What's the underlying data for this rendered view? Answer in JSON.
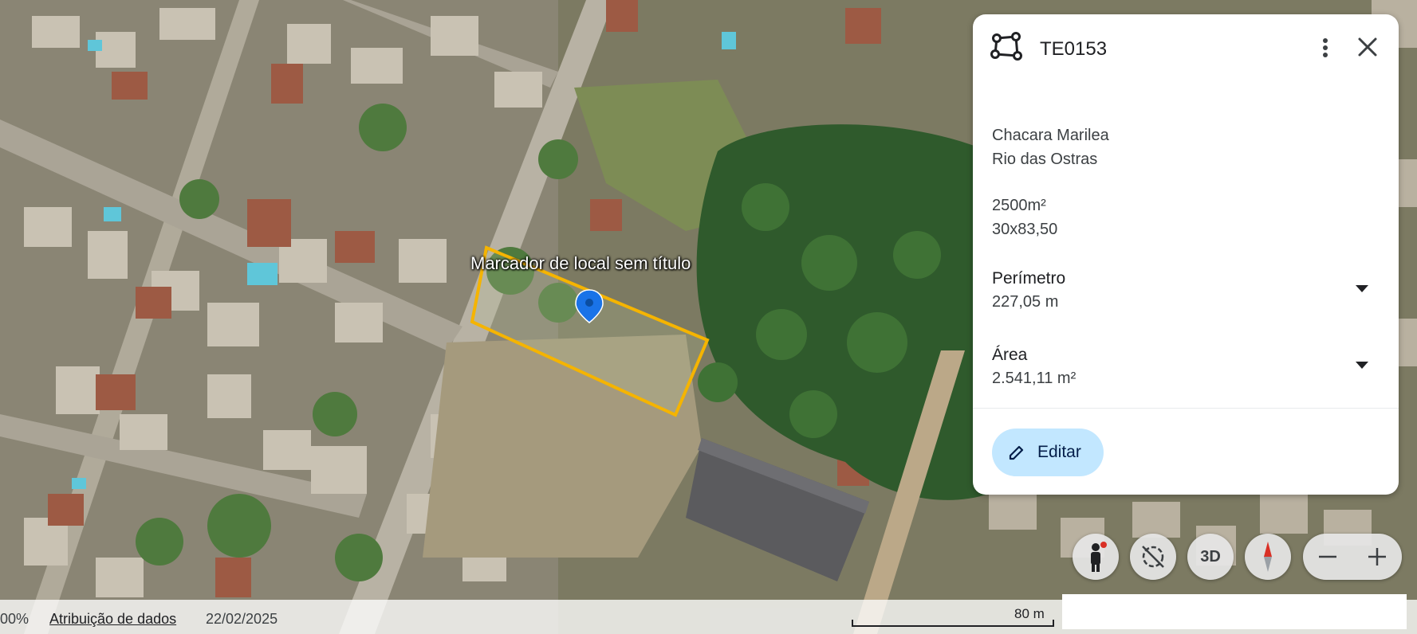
{
  "map": {
    "marker_label": "Marcador de local sem título",
    "polygon_color": "#f5b400",
    "pin_color": "#1a73e8"
  },
  "panel": {
    "icon": "polygon-shape-icon",
    "title": "TE0153",
    "description_lines": [
      "Chacara Marilea",
      "Rio das Ostras"
    ],
    "size_lines": [
      "2500m²",
      "30x83,50"
    ],
    "perimeter": {
      "label": "Perímetro",
      "value": "227,05 m"
    },
    "area": {
      "label": "Área",
      "value": "2.541,11 m²"
    },
    "edit_label": "Editar"
  },
  "controls": {
    "pegman_icon": "pegman-icon",
    "orbit_icon": "orbit-off-icon",
    "label_3d": "3D",
    "compass_icon": "compass-icon",
    "zoom_out_icon": "minus-icon",
    "zoom_in_icon": "plus-icon"
  },
  "footer": {
    "zoom_percent": "00%",
    "attribution": "Atribuição de dados",
    "date": "22/02/2025",
    "scale": "80 m"
  }
}
